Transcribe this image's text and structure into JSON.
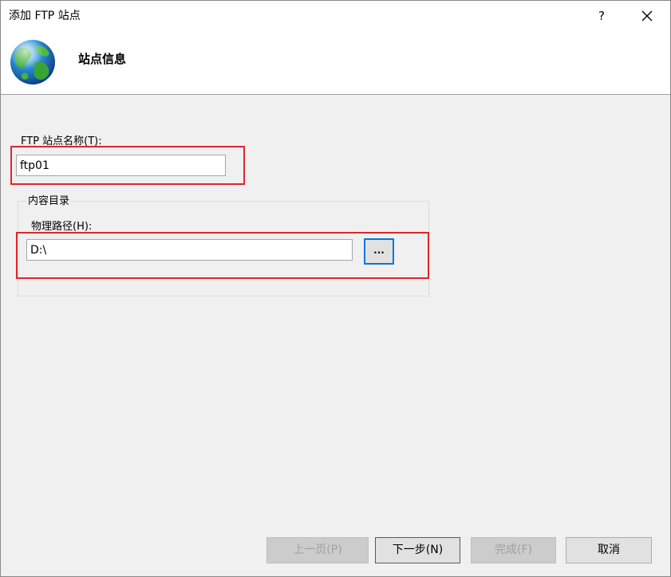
{
  "window": {
    "title": "添加 FTP 站点",
    "help_label": "?",
    "close_icon": "close-icon"
  },
  "header": {
    "icon": "globe-icon",
    "title": "站点信息"
  },
  "form": {
    "site_name_label": "FTP 站点名称(T):",
    "site_name_value": "ftp01",
    "content_group_label": "内容目录",
    "physical_path_label": "物理路径(H):",
    "physical_path_value": "D:\\",
    "browse_label": "..."
  },
  "footer": {
    "prev_label": "上一页(P)",
    "next_label": "下一步(N)",
    "finish_label": "完成(F)",
    "cancel_label": "取消"
  },
  "colors": {
    "highlight": "#e0252b",
    "focus_border": "#0078d7"
  }
}
